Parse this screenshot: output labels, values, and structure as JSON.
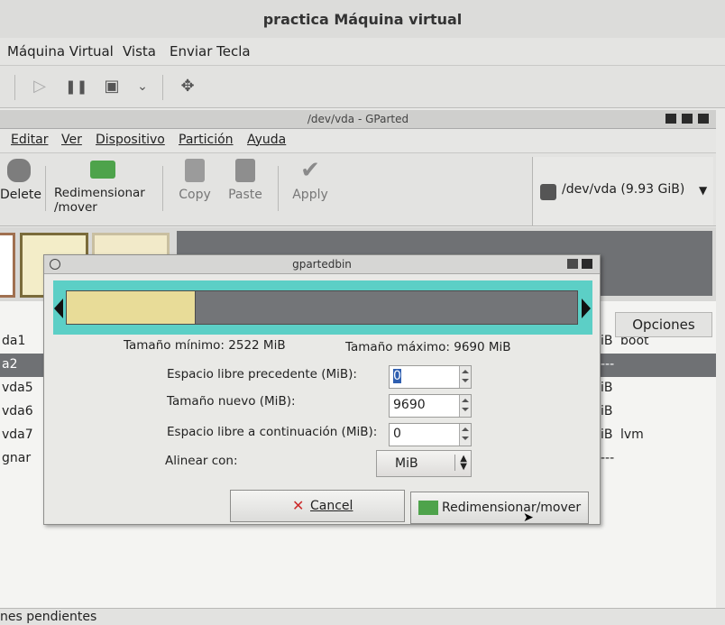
{
  "host": {
    "title": "practica Máquina virtual",
    "menu": [
      "Máquina Virtual",
      "Vista",
      "Enviar Tecla"
    ]
  },
  "gparted": {
    "title": "/dev/vda - GParted",
    "menu": [
      "Editar",
      "Ver",
      "Dispositivo",
      "Partición",
      "Ayuda"
    ],
    "toolbar": {
      "delete": "Delete",
      "resize_line1": "Redimensionar",
      "resize_line2": "/mover",
      "copy": "Copy",
      "paste": "Paste",
      "apply": "Apply"
    },
    "device": "/dev/vda  (9.93 GiB)",
    "columns": {
      "options": "Opciones"
    },
    "rows": [
      {
        "name": "da1",
        "flag": "iB",
        "opt": "boot"
      },
      {
        "name": "a2",
        "flag": "---",
        "opt": ""
      },
      {
        "name": "vda5",
        "flag": "iB",
        "opt": ""
      },
      {
        "name": "vda6",
        "flag": "iB",
        "opt": ""
      },
      {
        "name": "vda7",
        "flag": "iB",
        "opt": "lvm"
      },
      {
        "name": "gnar",
        "flag": "---",
        "opt": ""
      }
    ],
    "status": "nes pendientes"
  },
  "dialog": {
    "title": "gpartedbin",
    "min_size": "Tamaño mínimo: 2522 MiB",
    "max_size": "Tamaño máximo: 9690 MiB",
    "free_before_label": "Espacio libre precedente (MiB):",
    "free_before_value": "0",
    "new_size_label": "Tamaño nuevo (MiB):",
    "new_size_value": "9690",
    "free_after_label": "Espacio libre a continuación (MiB):",
    "free_after_value": "0",
    "align_label": "Alinear con:",
    "align_value": "MiB",
    "cancel": "Cancel",
    "resize_move": "Redimensionar/mover"
  },
  "colors": {
    "partition_fill": "#e8dc98",
    "resizer_border": "#5ccfc6",
    "unused": "#737578"
  }
}
